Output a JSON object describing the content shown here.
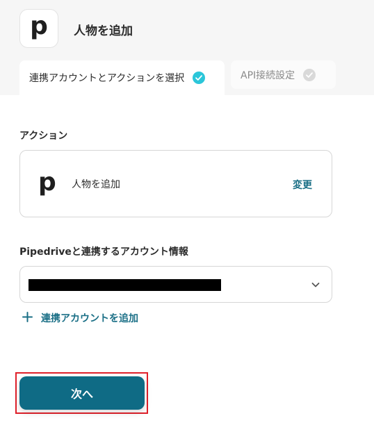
{
  "header": {
    "app_icon": "pipedrive-logo",
    "app_icon_letter": "p",
    "title": "人物を追加"
  },
  "tabs": [
    {
      "label": "連携アカウントとアクションを選択",
      "state": "active",
      "completed": true
    },
    {
      "label": "API接続設定",
      "state": "inactive",
      "completed": false
    }
  ],
  "action": {
    "section_label": "アクション",
    "icon": "pipedrive-logo",
    "icon_letter": "p",
    "name": "人物を追加",
    "change_label": "変更"
  },
  "account": {
    "section_label": "Pipedriveと連携するアカウント情報",
    "selected_value_redacted": true,
    "add_label": "連携アカウントを追加"
  },
  "footer": {
    "next_label": "次へ"
  },
  "colors": {
    "accent": "#0f6b85",
    "link": "#1a6f86",
    "check_active": "#2bc6d9",
    "highlight_border": "#e0202a"
  }
}
